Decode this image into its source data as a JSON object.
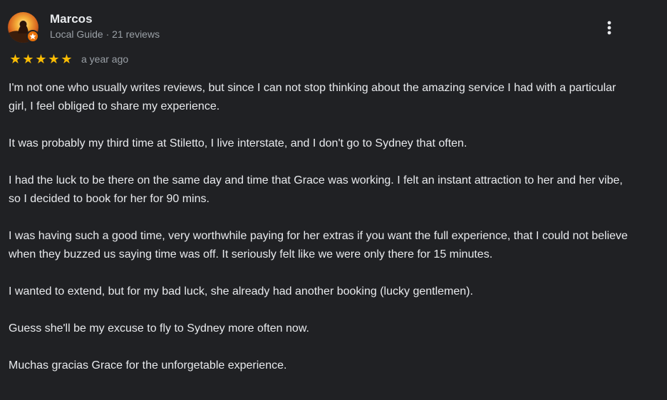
{
  "review": {
    "author": {
      "name": "Marcos",
      "meta": "Local Guide · 21 reviews",
      "avatar_icon": "avatar-photo-icon",
      "badge_icon": "local-guide-badge-icon"
    },
    "rating": {
      "stars": 5,
      "max": 5,
      "star_glyph": "★",
      "color": "#fbbc04"
    },
    "date": "a year ago",
    "menu_icon": "more-vert-icon",
    "paragraphs": [
      "I'm not one who usually writes reviews, but since I can not stop thinking about the amazing service I had with a particular girl, I feel obliged to share my experience.",
      "It was probably my third time at Stiletto, I live interstate, and I don't go to Sydney that often.",
      "I had the luck to be there on the same day and time that Grace was working. I felt an instant attraction to her and her vibe, so I decided to book for her for 90 mins.",
      "I was having such a good time, very worthwhile paying for her extras if you want the full experience, that I could not believe when they buzzed us saying time was off. It seriously felt like we were only there for 15 minutes.",
      "I wanted to extend, but for my bad luck, she already had another booking (lucky gentlemen).",
      "Guess she'll be my excuse to fly to Sydney more often now.",
      "Muchas gracias Grace for the unforgetable experience."
    ]
  },
  "colors": {
    "background": "#202124",
    "text": "#e8eaed",
    "secondary_text": "#9aa0a6",
    "star": "#fbbc04",
    "badge": "#e8710a"
  }
}
